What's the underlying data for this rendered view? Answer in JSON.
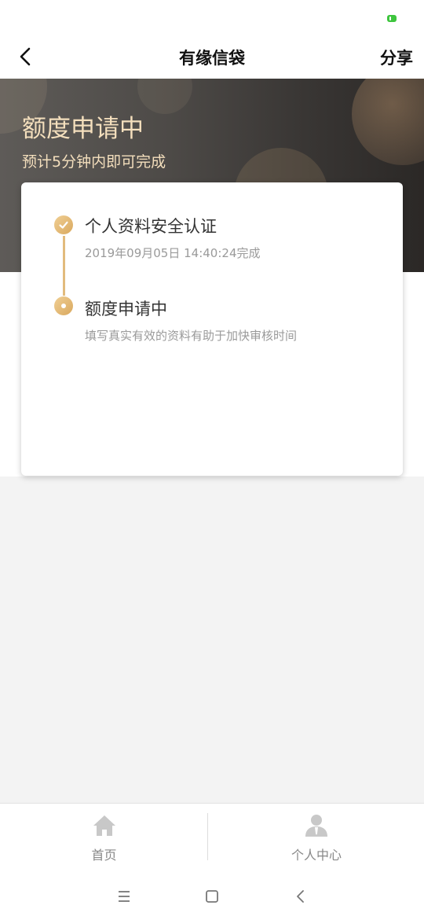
{
  "header": {
    "title": "有缘信袋",
    "share_label": "分享"
  },
  "banner": {
    "title": "额度申请中",
    "subtitle": "预计5分钟内即可完成"
  },
  "steps": [
    {
      "title": "个人资料安全认证",
      "desc": "2019年09月05日 14:40:24完成",
      "status": "done"
    },
    {
      "title": "额度申请中",
      "desc": "填写真实有效的资料有助于加快审核时间",
      "status": "active"
    }
  ],
  "tabbar": {
    "items": [
      {
        "label": "首页",
        "icon": "home-icon"
      },
      {
        "label": "个人中心",
        "icon": "user-icon"
      }
    ]
  },
  "colors": {
    "accent": "#e2bb7d",
    "banner_text": "#f4dfbd",
    "battery": "#3ec53e"
  }
}
